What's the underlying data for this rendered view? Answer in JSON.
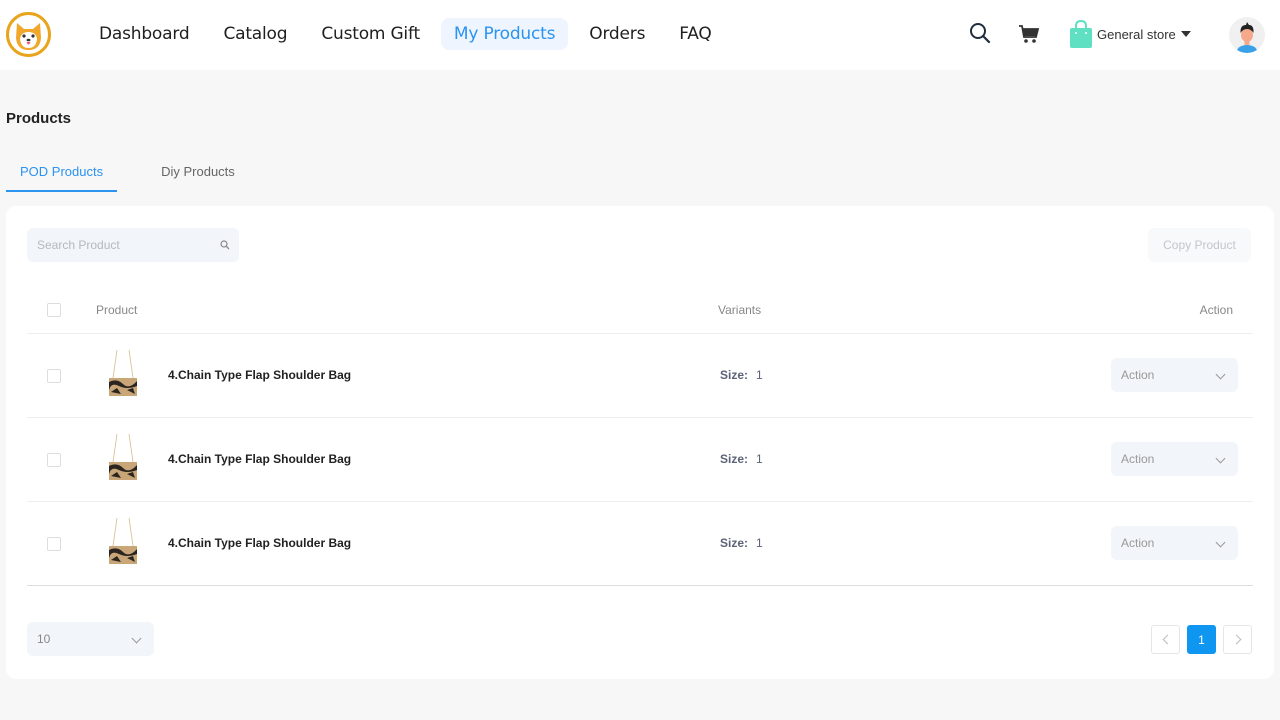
{
  "header": {
    "logo": "shiba-dog-logo",
    "nav": [
      {
        "label": "Dashboard",
        "active": false
      },
      {
        "label": "Catalog",
        "active": false
      },
      {
        "label": "Custom Gift",
        "active": false
      },
      {
        "label": "My Products",
        "active": true
      },
      {
        "label": "Orders",
        "active": false
      },
      {
        "label": "FAQ",
        "active": false
      }
    ],
    "icons": {
      "search": "search-icon",
      "cart": "cart-icon",
      "store": "shopping-bag-icon"
    },
    "store_label": "General store",
    "accent_color": "#2b93f0"
  },
  "page": {
    "title": "Products",
    "tabs": [
      {
        "label": "POD Products",
        "active": true
      },
      {
        "label": "Diy Products",
        "active": false
      }
    ]
  },
  "toolbar": {
    "search_placeholder": "Search Product",
    "search_value": "",
    "copy_label": "Copy Product"
  },
  "table": {
    "columns": {
      "product": "Product",
      "variants": "Variants",
      "action": "Action"
    },
    "rows": [
      {
        "name": "4.Chain Type Flap Shoulder Bag",
        "variant_label": "Size:",
        "variant_value": "1",
        "action": "Action"
      },
      {
        "name": "4.Chain Type Flap Shoulder Bag",
        "variant_label": "Size:",
        "variant_value": "1",
        "action": "Action"
      },
      {
        "name": "4.Chain Type Flap Shoulder Bag",
        "variant_label": "Size:",
        "variant_value": "1",
        "action": "Action"
      }
    ]
  },
  "pagination": {
    "page_size": "10",
    "current_page": "1"
  }
}
